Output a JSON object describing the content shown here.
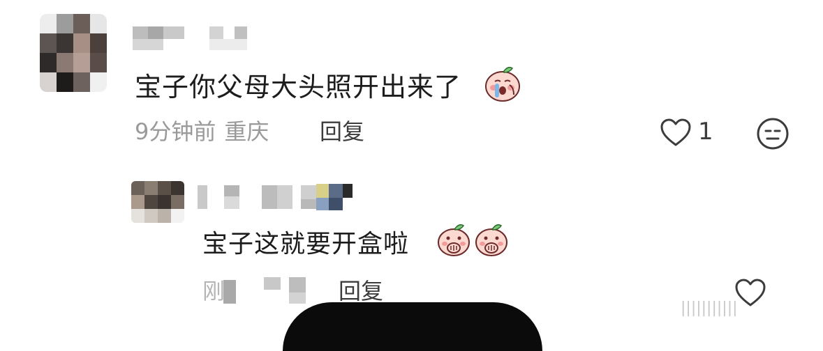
{
  "comment": {
    "text": "宝子你父母大头照开出来了",
    "time": "9分钟前",
    "location": "重庆",
    "reply_label": "回复",
    "like_count": "1",
    "emoji": "crying-peach-sticker"
  },
  "reply": {
    "text": "宝子这就要开盒啦",
    "time_prefix": "刚",
    "reply_label": "回复",
    "emoji": "peach-hand-over-mouth-sticker"
  },
  "icons": {
    "like": "heart-outline-icon",
    "dislike": "unimpressed-face-icon"
  },
  "watermark": "|||||||||||"
}
